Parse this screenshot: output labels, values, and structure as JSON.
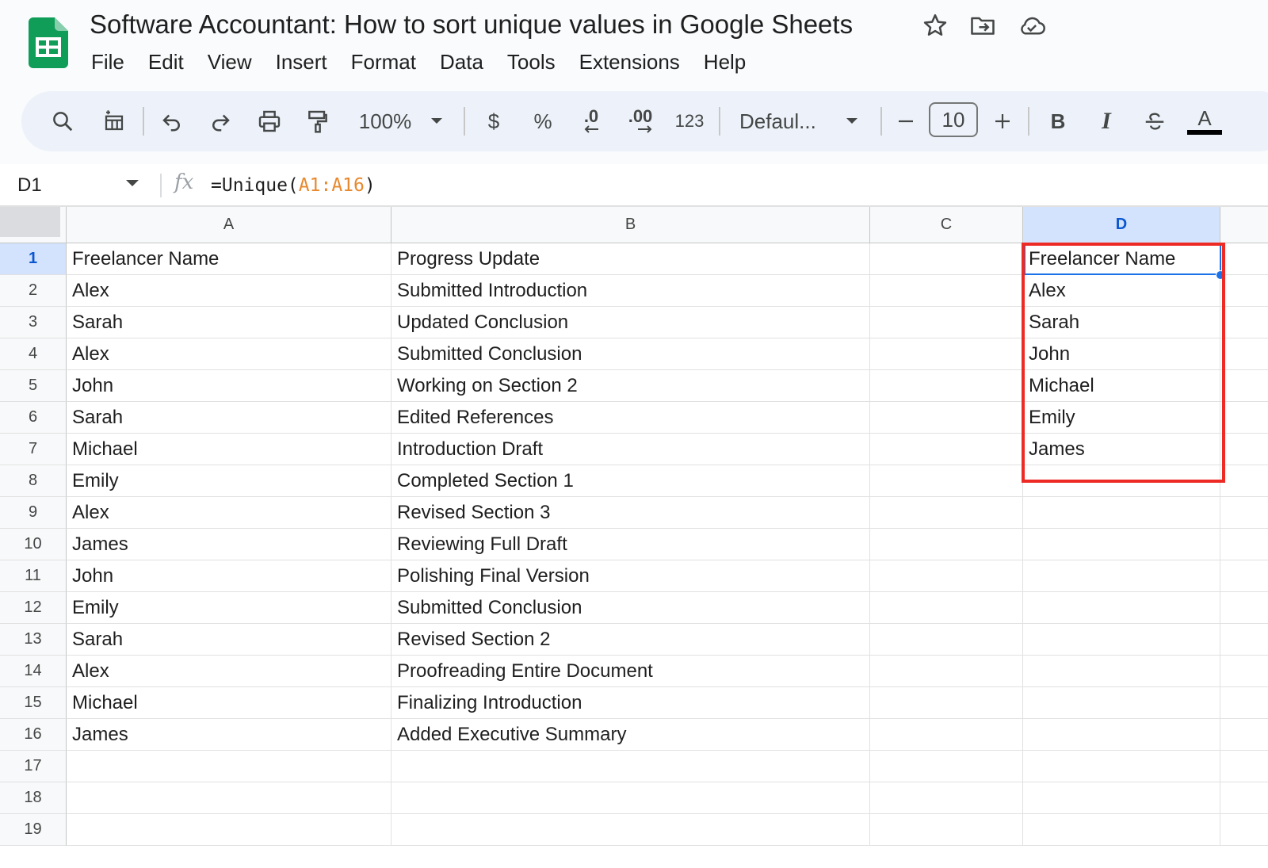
{
  "document": {
    "title": "Software Accountant: How to sort unique values in Google Sheets"
  },
  "title_icons": [
    "star-icon",
    "move-to-folder-icon",
    "cloud-saved-icon"
  ],
  "menu": [
    "File",
    "Edit",
    "View",
    "Insert",
    "Format",
    "Data",
    "Tools",
    "Extensions",
    "Help"
  ],
  "toolbar": {
    "zoom": "100%",
    "currency": "$",
    "percent": "%",
    "decrease_decimal": ".0",
    "increase_decimal": ".00",
    "number_format": "123",
    "font": "Defaul...",
    "font_size": "10",
    "bold": "B",
    "italic": "I",
    "text_color": "A"
  },
  "formula_bar": {
    "cell_ref": "D1",
    "fx": "fx",
    "formula_prefix": "=Unique(",
    "formula_range": "A1:A16",
    "formula_suffix": ")"
  },
  "grid": {
    "columns": [
      "A",
      "B",
      "C",
      "D"
    ],
    "selected_column": "D",
    "selected_row": 1,
    "row_numbers": [
      "1",
      "2",
      "3",
      "4",
      "5",
      "6",
      "7",
      "8",
      "9",
      "10",
      "11",
      "12",
      "13",
      "14",
      "15",
      "16",
      "17",
      "18",
      "19"
    ],
    "rows": [
      [
        "Freelancer Name",
        "Progress Update",
        "",
        "Freelancer Name"
      ],
      [
        "Alex",
        "Submitted Introduction",
        "",
        "Alex"
      ],
      [
        "Sarah",
        "Updated Conclusion",
        "",
        "Sarah"
      ],
      [
        "Alex",
        "Submitted Conclusion",
        "",
        "John"
      ],
      [
        "John",
        "Working on Section 2",
        "",
        "Michael"
      ],
      [
        "Sarah",
        "Edited References",
        "",
        "Emily"
      ],
      [
        "Michael",
        "Introduction Draft",
        "",
        "James"
      ],
      [
        "Emily",
        "Completed Section 1",
        "",
        ""
      ],
      [
        "Alex",
        "Revised Section 3",
        "",
        ""
      ],
      [
        "James",
        "Reviewing Full Draft",
        "",
        ""
      ],
      [
        "John",
        "Polishing Final Version",
        "",
        ""
      ],
      [
        "Emily",
        "Submitted Conclusion",
        "",
        ""
      ],
      [
        "Sarah",
        "Revised Section 2",
        "",
        ""
      ],
      [
        "Alex",
        "Proofreading Entire Document",
        "",
        ""
      ],
      [
        "Michael",
        "Finalizing Introduction",
        "",
        ""
      ],
      [
        "James",
        "Added Executive Summary",
        "",
        ""
      ],
      [
        "",
        "",
        "",
        ""
      ],
      [
        "",
        "",
        "",
        ""
      ],
      [
        "",
        "",
        "",
        ""
      ]
    ]
  },
  "colors": {
    "selection_blue": "#1a73e8",
    "highlight_red": "#ee2a24",
    "formula_range": "#e8892d",
    "toolbar_bg": "#edf2fa",
    "header_bg": "#f8f9fa"
  }
}
